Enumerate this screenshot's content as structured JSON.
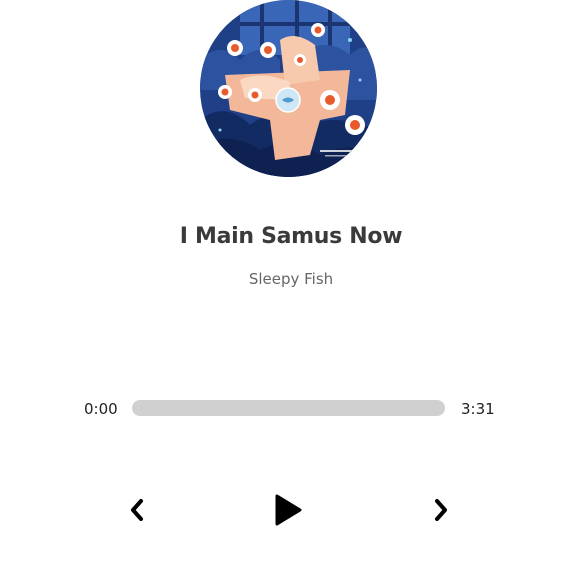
{
  "track": {
    "title": "I Main Samus Now",
    "artist": "Sleepy Fish",
    "cover_icon": "album-art-illustration"
  },
  "player": {
    "current_time": "0:00",
    "total_time": "3:31",
    "progress_fraction": 0
  },
  "controls": {
    "prev_icon": "chevron-left-icon",
    "play_icon": "play-icon",
    "next_icon": "chevron-right-icon"
  },
  "colors": {
    "track_bar": "#d0d0d0",
    "text_dark": "#333333",
    "text_muted": "#666666"
  }
}
